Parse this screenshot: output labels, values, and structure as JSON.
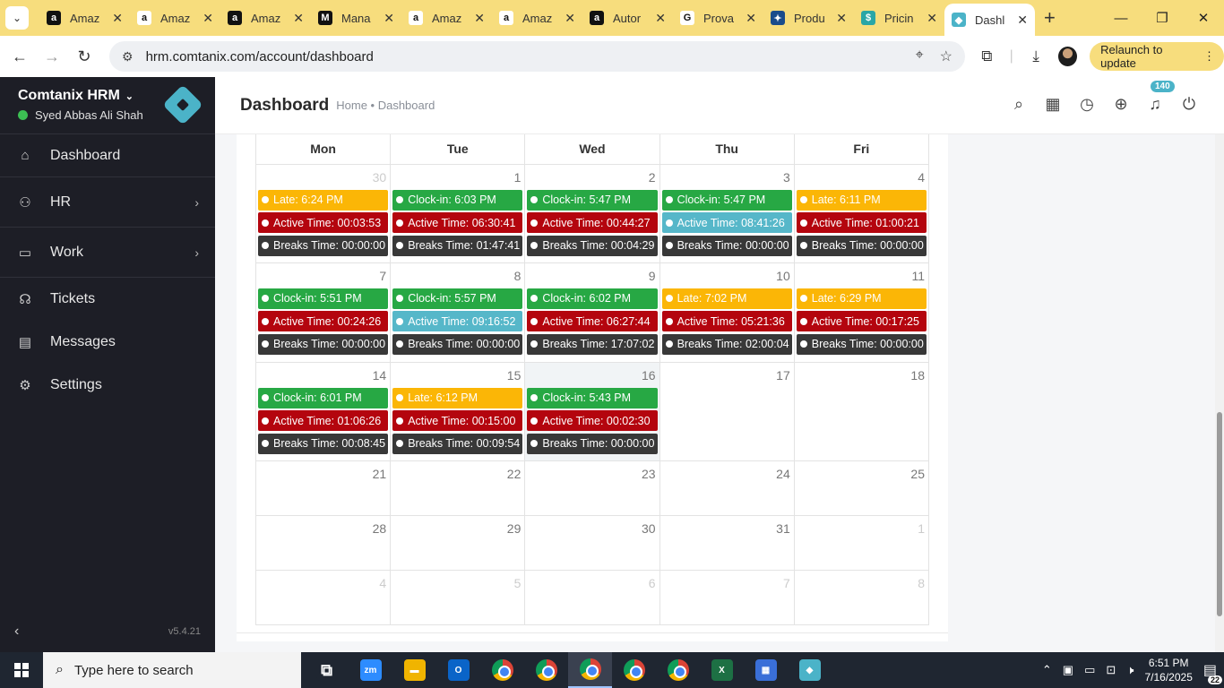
{
  "browser": {
    "tabs": [
      {
        "title": "Amaz",
        "icon": "amazon-icon",
        "color": "#111111",
        "glyph": "a"
      },
      {
        "title": "Amaz",
        "icon": "amazon-icon",
        "color": "#ffffff",
        "glyph": "a"
      },
      {
        "title": "Amaz",
        "icon": "amazon-icon",
        "color": "#111111",
        "glyph": "a"
      },
      {
        "title": "Mana",
        "icon": "manager-icon",
        "color": "#111111",
        "glyph": "M"
      },
      {
        "title": "Amaz",
        "icon": "amazon-icon",
        "color": "#ffffff",
        "glyph": "a"
      },
      {
        "title": "Amaz",
        "icon": "amazon-icon",
        "color": "#ffffff",
        "glyph": "a"
      },
      {
        "title": "Autor",
        "icon": "amazon-author-icon",
        "color": "#111111",
        "glyph": "a"
      },
      {
        "title": "Prova",
        "icon": "google-icon",
        "color": "#ffffff",
        "glyph": "G"
      },
      {
        "title": "Produ",
        "icon": "product-icon",
        "color": "#1a4c8b",
        "glyph": "✦"
      },
      {
        "title": "Pricin",
        "icon": "dollar-icon",
        "color": "#2aa6a6",
        "glyph": "$"
      },
      {
        "title": "Dashl",
        "icon": "comtanix-icon",
        "color": "#4bb3c8",
        "glyph": "◆",
        "active": true
      }
    ],
    "url": "hrm.comtanix.com/account/dashboard",
    "relaunch_label": "Relaunch to update"
  },
  "sidebar": {
    "org_name": "Comtanix HRM",
    "user_name": "Syed Abbas Ali Shah",
    "items": [
      {
        "label": "Dashboard",
        "icon": "home-icon"
      },
      {
        "label": "HR",
        "icon": "users-icon"
      },
      {
        "label": "Work",
        "icon": "briefcase-icon"
      },
      {
        "label": "Tickets",
        "icon": "headset-icon"
      },
      {
        "label": "Messages",
        "icon": "message-icon"
      },
      {
        "label": "Settings",
        "icon": "gear-icon"
      }
    ],
    "version": "v5.4.21"
  },
  "header": {
    "title": "Dashboard",
    "breadcrumb": "Home • Dashboard",
    "notification_count": "140"
  },
  "calendar": {
    "weekdays": [
      "Mon",
      "Tue",
      "Wed",
      "Thu",
      "Fri"
    ],
    "weeks": [
      [
        {
          "day": "30",
          "other": true,
          "events": [
            [
              "yellow",
              "Late: 6:24 PM"
            ],
            [
              "red",
              "Active Time: 00:03:53"
            ],
            [
              "dark",
              "Breaks Time: 00:00:00"
            ]
          ]
        },
        {
          "day": "1",
          "events": [
            [
              "green",
              "Clock-in: 6:03 PM"
            ],
            [
              "red",
              "Active Time: 06:30:41"
            ],
            [
              "dark",
              "Breaks Time: 01:47:41"
            ]
          ]
        },
        {
          "day": "2",
          "events": [
            [
              "green",
              "Clock-in: 5:47 PM"
            ],
            [
              "red",
              "Active Time: 00:44:27"
            ],
            [
              "dark",
              "Breaks Time: 00:04:29"
            ]
          ]
        },
        {
          "day": "3",
          "events": [
            [
              "green",
              "Clock-in: 5:47 PM"
            ],
            [
              "teal",
              "Active Time: 08:41:26"
            ],
            [
              "dark",
              "Breaks Time: 00:00:00"
            ]
          ]
        },
        {
          "day": "4",
          "events": [
            [
              "yellow",
              "Late: 6:11 PM"
            ],
            [
              "red",
              "Active Time: 01:00:21"
            ],
            [
              "dark",
              "Breaks Time: 00:00:00"
            ]
          ]
        }
      ],
      [
        {
          "day": "7",
          "events": [
            [
              "green",
              "Clock-in: 5:51 PM"
            ],
            [
              "red",
              "Active Time: 00:24:26"
            ],
            [
              "dark",
              "Breaks Time: 00:00:00"
            ]
          ]
        },
        {
          "day": "8",
          "events": [
            [
              "green",
              "Clock-in: 5:57 PM"
            ],
            [
              "teal",
              "Active Time: 09:16:52"
            ],
            [
              "dark",
              "Breaks Time: 00:00:00"
            ]
          ]
        },
        {
          "day": "9",
          "events": [
            [
              "green",
              "Clock-in: 6:02 PM"
            ],
            [
              "red",
              "Active Time: 06:27:44"
            ],
            [
              "dark",
              "Breaks Time: 17:07:02"
            ]
          ]
        },
        {
          "day": "10",
          "events": [
            [
              "yellow",
              "Late: 7:02 PM"
            ],
            [
              "red",
              "Active Time: 05:21:36"
            ],
            [
              "dark",
              "Breaks Time: 02:00:04"
            ]
          ]
        },
        {
          "day": "11",
          "events": [
            [
              "yellow",
              "Late: 6:29 PM"
            ],
            [
              "red",
              "Active Time: 00:17:25"
            ],
            [
              "dark",
              "Breaks Time: 00:00:00"
            ]
          ]
        }
      ],
      [
        {
          "day": "14",
          "events": [
            [
              "green",
              "Clock-in: 6:01 PM"
            ],
            [
              "red",
              "Active Time: 01:06:26"
            ],
            [
              "dark",
              "Breaks Time: 00:08:45"
            ]
          ]
        },
        {
          "day": "15",
          "events": [
            [
              "yellow",
              "Late: 6:12 PM"
            ],
            [
              "red",
              "Active Time: 00:15:00"
            ],
            [
              "dark",
              "Breaks Time: 00:09:54"
            ]
          ]
        },
        {
          "day": "16",
          "today": true,
          "events": [
            [
              "green",
              "Clock-in: 5:43 PM"
            ],
            [
              "red",
              "Active Time: 00:02:30"
            ],
            [
              "dark",
              "Breaks Time: 00:00:00"
            ]
          ]
        },
        {
          "day": "17",
          "events": []
        },
        {
          "day": "18",
          "events": []
        }
      ],
      [
        {
          "day": "21",
          "events": []
        },
        {
          "day": "22",
          "events": []
        },
        {
          "day": "23",
          "events": []
        },
        {
          "day": "24",
          "events": []
        },
        {
          "day": "25",
          "events": []
        }
      ],
      [
        {
          "day": "28",
          "events": []
        },
        {
          "day": "29",
          "events": []
        },
        {
          "day": "30",
          "events": []
        },
        {
          "day": "31",
          "events": []
        },
        {
          "day": "1",
          "other": true,
          "events": []
        }
      ],
      [
        {
          "day": "4",
          "other": true,
          "events": []
        },
        {
          "day": "5",
          "other": true,
          "events": []
        },
        {
          "day": "6",
          "other": true,
          "events": []
        },
        {
          "day": "7",
          "other": true,
          "events": []
        },
        {
          "day": "8",
          "other": true,
          "events": []
        }
      ]
    ],
    "colors": {
      "green": "#27a844",
      "yellow": "#fbb606",
      "red": "#b4050e",
      "teal": "#56b7c9",
      "dark": "#383838"
    }
  },
  "taskbar": {
    "search_placeholder": "Type here to search",
    "apps": [
      "task-view-icon",
      "zoom-icon",
      "file-explorer-icon",
      "outlook-icon",
      "chrome-icon",
      "chrome-icon",
      "chrome-icon",
      "chrome-icon",
      "chrome-icon",
      "excel-icon",
      "calculator-icon",
      "comtanix-icon"
    ],
    "time": "6:51 PM",
    "date": "7/16/2025",
    "notification_count": "22"
  }
}
